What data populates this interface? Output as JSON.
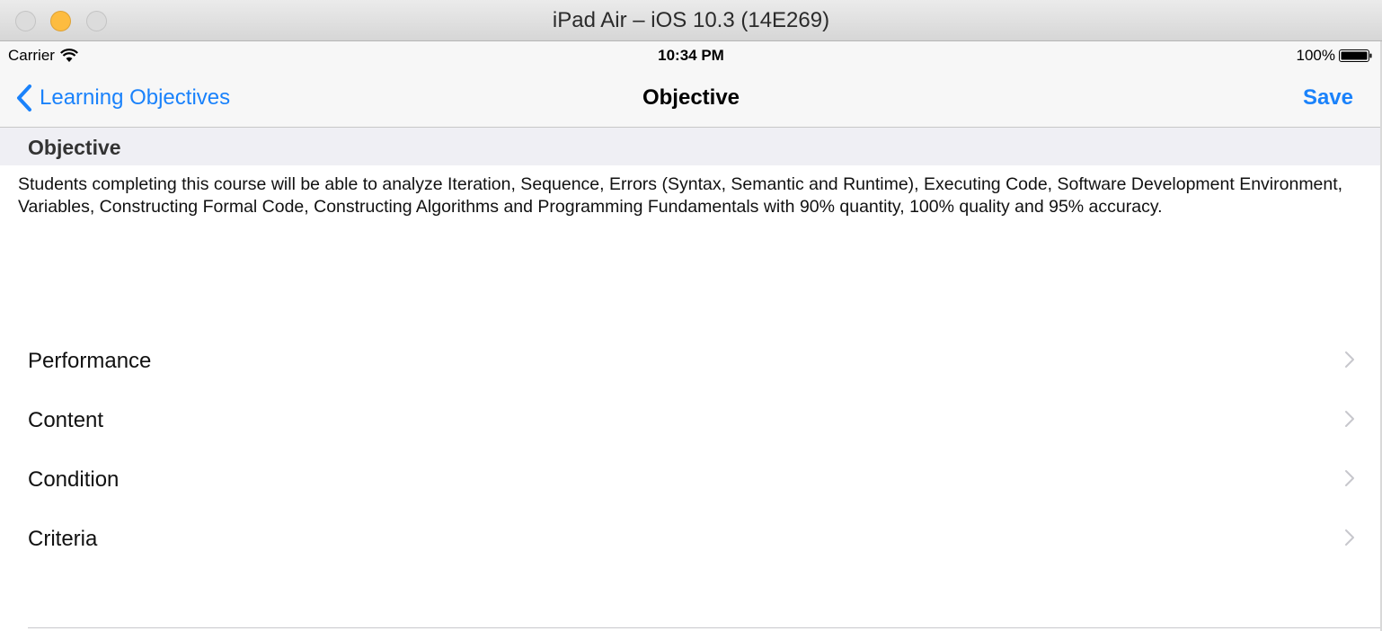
{
  "window": {
    "title": "iPad Air – iOS 10.3 (14E269)"
  },
  "status_bar": {
    "carrier": "Carrier",
    "time": "10:34 PM",
    "battery_percent": "100%",
    "battery_level": 1.0
  },
  "nav_bar": {
    "back_label": "Learning Objectives",
    "title": "Objective",
    "save_label": "Save"
  },
  "section": {
    "header": "Objective",
    "text": "Students completing this course will be able to analyze Iteration, Sequence, Errors (Syntax, Semantic and Runtime), Executing Code, Software Development Environment, Variables, Constructing Formal Code, Constructing Algorithms and Programming Fundamentals with 90% quantity, 100% quality and 95% accuracy."
  },
  "rows": [
    {
      "label": "Performance"
    },
    {
      "label": "Content"
    },
    {
      "label": "Condition"
    },
    {
      "label": "Criteria"
    }
  ],
  "colors": {
    "accent": "#1a82fb",
    "minimize_button": "#fdbc40",
    "section_background": "#efeff4"
  }
}
